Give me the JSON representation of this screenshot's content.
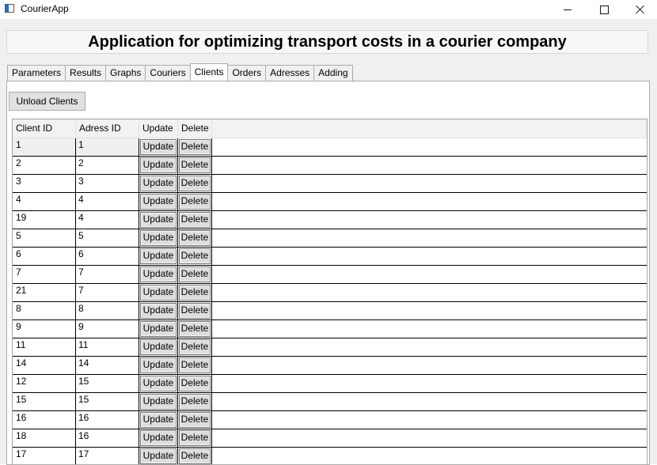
{
  "window": {
    "title": "CourierApp",
    "icon": "app-window-icon"
  },
  "header": {
    "title": "Application for optimizing transport costs in a courier company"
  },
  "tabs": [
    {
      "label": "Parameters",
      "active": false
    },
    {
      "label": "Results",
      "active": false
    },
    {
      "label": "Graphs",
      "active": false
    },
    {
      "label": "Couriers",
      "active": false
    },
    {
      "label": "Clients",
      "active": true
    },
    {
      "label": "Orders",
      "active": false
    },
    {
      "label": "Adresses",
      "active": false
    },
    {
      "label": "Adding",
      "active": false
    }
  ],
  "clients": {
    "unload_label": "Unload Clients",
    "columns": [
      "Client ID",
      "Adress ID",
      "Update",
      "Delete"
    ],
    "update_label": "Update",
    "delete_label": "Delete",
    "rows": [
      {
        "client_id": "1",
        "adress_id": "1"
      },
      {
        "client_id": "2",
        "adress_id": "2"
      },
      {
        "client_id": "3",
        "adress_id": "3"
      },
      {
        "client_id": "4",
        "adress_id": "4"
      },
      {
        "client_id": "19",
        "adress_id": "4"
      },
      {
        "client_id": "5",
        "adress_id": "5"
      },
      {
        "client_id": "6",
        "adress_id": "6"
      },
      {
        "client_id": "7",
        "adress_id": "7"
      },
      {
        "client_id": "21",
        "adress_id": "7"
      },
      {
        "client_id": "8",
        "adress_id": "8"
      },
      {
        "client_id": "9",
        "adress_id": "9"
      },
      {
        "client_id": "11",
        "adress_id": "11"
      },
      {
        "client_id": "14",
        "adress_id": "14"
      },
      {
        "client_id": "12",
        "adress_id": "15"
      },
      {
        "client_id": "15",
        "adress_id": "15"
      },
      {
        "client_id": "16",
        "adress_id": "16"
      },
      {
        "client_id": "18",
        "adress_id": "16"
      },
      {
        "client_id": "17",
        "adress_id": "17"
      }
    ]
  }
}
